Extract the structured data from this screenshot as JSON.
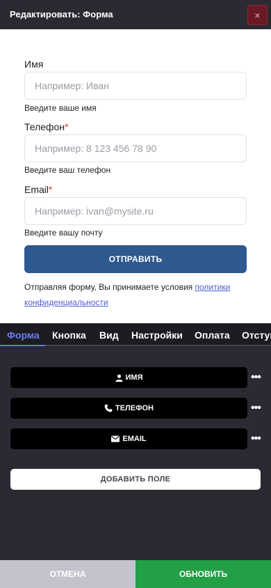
{
  "header": {
    "title": "Редактировать: Форма",
    "close_icon": "×"
  },
  "form_preview": {
    "fields": [
      {
        "label": "Имя",
        "required": false,
        "placeholder": "Например: Иван",
        "hint": "Введите ваше имя"
      },
      {
        "label": "Телефон",
        "required": true,
        "placeholder": "Например: 8 123 456 78 90",
        "hint": "Введите ваш телефон"
      },
      {
        "label": "Email",
        "required": true,
        "placeholder": "Например: ivan@mysite.ru",
        "hint": "Введите вашу почту"
      }
    ],
    "required_mark": "*",
    "submit_label": "ОТПРАВИТЬ",
    "consent_text": "Отправляя форму, Вы принимаете условия ",
    "consent_link": "политики конфиденциальности"
  },
  "tabs": [
    "Форма",
    "Кнопка",
    "Вид",
    "Настройки",
    "Оплата",
    "Отступы"
  ],
  "active_tab": "Форма",
  "field_list": [
    {
      "label": "ИМЯ",
      "icon": "user-icon"
    },
    {
      "label": "ТЕЛЕФОН",
      "icon": "phone-icon"
    },
    {
      "label": "EMAIL",
      "icon": "envelope-icon"
    }
  ],
  "more_icon": "•••",
  "add_field_label": "ДОБАВИТЬ ПОЛЕ",
  "footer": {
    "cancel_label": "ОТМЕНА",
    "update_label": "ОБНОВИТЬ"
  },
  "colors": {
    "accent": "#6a7cf0",
    "submit": "#2d5890",
    "update": "#21a045",
    "cancel": "#c2c3cc",
    "close": "#6a1a24"
  }
}
